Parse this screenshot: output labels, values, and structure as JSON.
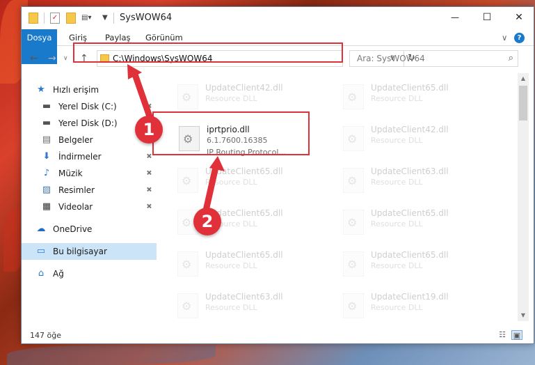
{
  "window": {
    "title": "SysWOW64",
    "minimize": "—",
    "maximize": "☐",
    "close": "✕"
  },
  "ribbon": {
    "tabs": [
      "Dosya",
      "Giriş",
      "Paylaş",
      "Görünüm"
    ],
    "collapse": "∨",
    "help": "?"
  },
  "address": {
    "path": "C:\\Windows\\SysWOW64",
    "dropdown": "∨",
    "refresh": "↻"
  },
  "search": {
    "placeholder": "Ara: SysWOW64"
  },
  "sidebar": {
    "items": [
      {
        "label": "Hızlı erişim",
        "icon": "star-icon",
        "glyph": "★",
        "color": "#2b79d0"
      },
      {
        "label": "Yerel Disk (C:)",
        "icon": "drive-icon",
        "glyph": "▬",
        "color": "#555555",
        "pinned": true
      },
      {
        "label": "Yerel Disk (D:)",
        "icon": "drive-icon",
        "glyph": "▬",
        "color": "#555555"
      },
      {
        "label": "Belgeler",
        "icon": "document-icon",
        "glyph": "▤",
        "color": "#6b6b6b",
        "pinned": true
      },
      {
        "label": "İndirmeler",
        "icon": "download-icon",
        "glyph": "⬇",
        "color": "#2b79d0",
        "pinned": true
      },
      {
        "label": "Müzik",
        "icon": "music-icon",
        "glyph": "♪",
        "color": "#2b79d0",
        "pinned": true
      },
      {
        "label": "Resimler",
        "icon": "picture-icon",
        "glyph": "▨",
        "color": "#4a7aa8",
        "pinned": true
      },
      {
        "label": "Videolar",
        "icon": "video-icon",
        "glyph": "▦",
        "color": "#333333",
        "pinned": true
      },
      {
        "label": "OneDrive",
        "icon": "cloud-icon",
        "glyph": "☁",
        "color": "#1e6fc4"
      },
      {
        "label": "Bu bilgisayar",
        "icon": "computer-icon",
        "glyph": "▭",
        "color": "#2b79d0"
      },
      {
        "label": "Ağ",
        "icon": "network-icon",
        "glyph": "⌂",
        "color": "#2b79d0"
      }
    ],
    "pin_glyph": "📌"
  },
  "files": {
    "highlighted": {
      "name": "iprtprio.dll",
      "version": "6.1.7600.16385",
      "description": "IP Routing Protocol..."
    },
    "faded": [
      {
        "name": "UpdateClient42.dll",
        "desc": "Resource DLL"
      },
      {
        "name": "UpdateClient65.dll",
        "desc": "Resource DLL"
      },
      {
        "name": "UpdateClient42.dll",
        "desc": "Resource DLL"
      },
      {
        "name": "UpdateClient65.dll",
        "desc": "Resource DLL"
      },
      {
        "name": "UpdateClient63.dll",
        "desc": "Resource DLL"
      },
      {
        "name": "UpdateClient65.dll",
        "desc": "Resource DLL"
      },
      {
        "name": "UpdateClient65.dll",
        "desc": "Resource DLL"
      },
      {
        "name": "UpdateClient65.dll",
        "desc": "Resource DLL"
      },
      {
        "name": "UpdateClient65.dll",
        "desc": "Resource DLL"
      },
      {
        "name": "UpdateClient63.dll",
        "desc": "Resource DLL"
      },
      {
        "name": "UpdateClient19.dll",
        "desc": "Resource DLL"
      }
    ]
  },
  "status": {
    "count": "147 öğe"
  },
  "annotations": {
    "step1": "1",
    "step2": "2",
    "color": "#e0303a"
  }
}
